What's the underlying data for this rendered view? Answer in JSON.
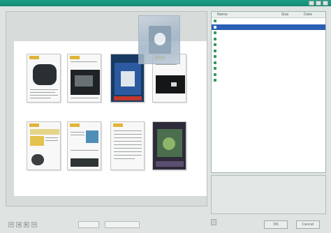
{
  "window": {
    "title": ""
  },
  "file_list": {
    "columns": [
      "Name",
      "Size",
      "Date"
    ],
    "items": [
      {
        "name": ""
      },
      {
        "name": "",
        "selected": true
      },
      {
        "name": ""
      },
      {
        "name": ""
      },
      {
        "name": ""
      },
      {
        "name": ""
      },
      {
        "name": ""
      },
      {
        "name": ""
      },
      {
        "name": ""
      },
      {
        "name": ""
      },
      {
        "name": ""
      }
    ]
  },
  "info": {
    "title": "",
    "fields": [
      {
        "label": "",
        "value": "",
        "label2": "",
        "value2": ""
      },
      {
        "label": "",
        "value": "",
        "label2": "",
        "value2": ""
      },
      {
        "label": "",
        "value": "",
        "label2": "",
        "value2": ""
      },
      {
        "label": "",
        "value": ""
      }
    ]
  },
  "status": {
    "page_label": "",
    "page_value": "",
    "size_value": ""
  },
  "buttons": {
    "ok": "OK",
    "cancel": "Cancel"
  },
  "colors": {
    "titlebar": "#1f9e87",
    "selection": "#2b5fb5",
    "file_icon": "#2f9a55",
    "accent": "#e0b43a"
  }
}
